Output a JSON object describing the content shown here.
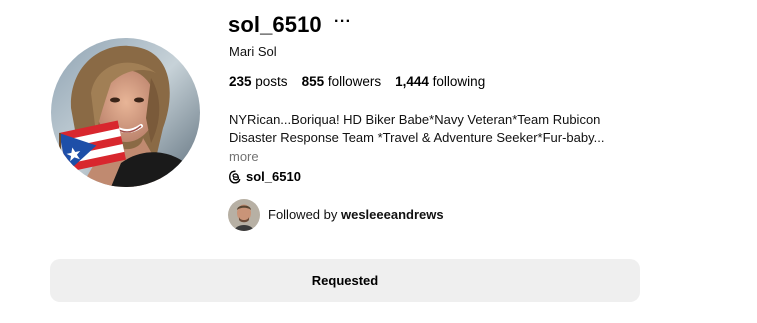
{
  "profile": {
    "username": "sol_6510",
    "more_options_label": "···",
    "full_name": "Mari Sol",
    "avatar_icon": "profile-photo",
    "stats": {
      "posts_count": "235",
      "posts_label": "posts",
      "followers_count": "855",
      "followers_label": "followers",
      "following_count": "1,444",
      "following_label": "following"
    },
    "bio": {
      "line1": "NYRican...Boriqua! HD Biker Babe*Navy Veteran*Team Rubicon",
      "line2": "Disaster Response Team *Travel & Adventure Seeker*Fur-baby...",
      "more_label": "more"
    },
    "threads": {
      "icon": "threads-icon",
      "handle": "sol_6510"
    },
    "followed_by": {
      "prefix": "Followed by",
      "name": "wesleeeandrews",
      "avatar_icon": "follower-avatar"
    },
    "action_button_label": "Requested"
  }
}
